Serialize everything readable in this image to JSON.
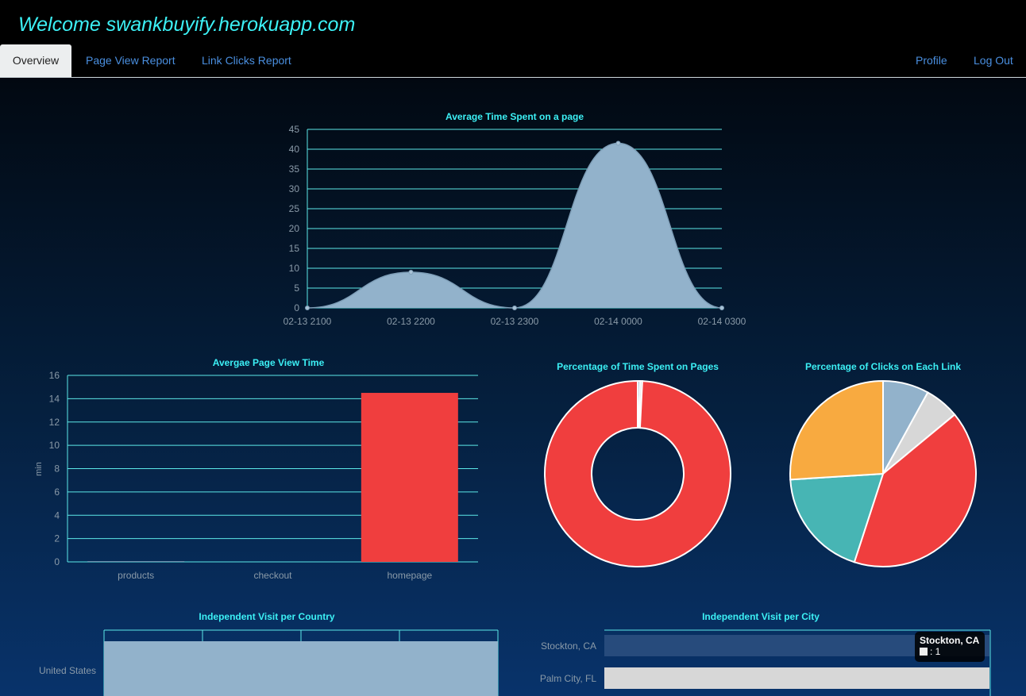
{
  "header": {
    "title": "Welcome swankbuyify.herokuapp.com"
  },
  "nav": {
    "left": [
      {
        "label": "Overview",
        "active": true
      },
      {
        "label": "Page View Report"
      },
      {
        "label": "Link Clicks Report"
      }
    ],
    "right": [
      {
        "label": "Profile"
      },
      {
        "label": "Log Out"
      }
    ]
  },
  "colors": {
    "title": "#3cf0f5",
    "grid": "#5ce8e8",
    "area": "#92b2cb",
    "red": "#f03e3e",
    "orange": "#f8aa40",
    "teal": "#47b5b4",
    "grey": "#d7d7d7",
    "blue_bar": "#274b7c"
  },
  "tooltip": {
    "title": "Stockton, CA",
    "value": ": 1"
  },
  "chart_data": [
    {
      "type": "area",
      "title": "Average Time Spent on a page",
      "x": [
        "02-13 2100",
        "02-13 2200",
        "02-13 2300",
        "02-14 0000",
        "02-14 0300"
      ],
      "values": [
        0,
        9,
        0,
        41.5,
        0
      ],
      "ylim": [
        0,
        45
      ],
      "yticks": [
        0,
        5,
        10,
        15,
        20,
        25,
        30,
        35,
        40,
        45
      ],
      "grid": true
    },
    {
      "type": "bar",
      "title": "Avergae Page View Time",
      "categories": [
        "products",
        "checkout",
        "homepage"
      ],
      "values": [
        0.05,
        0,
        14.5
      ],
      "ylabel": "min",
      "ylim": [
        0,
        16
      ],
      "yticks": [
        0,
        2,
        4,
        6,
        8,
        10,
        12,
        14,
        16
      ],
      "grid": true
    },
    {
      "type": "pie",
      "donut": true,
      "title": "Percentage of Time Spent on Pages",
      "values": [
        0.4,
        0.4,
        99.2
      ]
    },
    {
      "type": "pie",
      "title": "Percentage of Clicks on Each Link",
      "values": [
        8,
        6,
        41,
        19,
        26
      ]
    },
    {
      "type": "bar",
      "orientation": "horizontal",
      "title": "Independent Visit per Country",
      "categories": [
        "United States"
      ],
      "values": [
        4
      ],
      "xlim": [
        0,
        4
      ],
      "grid": true
    },
    {
      "type": "bar",
      "orientation": "horizontal",
      "title": "Independent Visit per City",
      "categories": [
        "Stockton, CA",
        "Palm City, FL"
      ],
      "values": [
        1,
        1
      ],
      "xlim": [
        0,
        1
      ],
      "grid": true
    }
  ]
}
